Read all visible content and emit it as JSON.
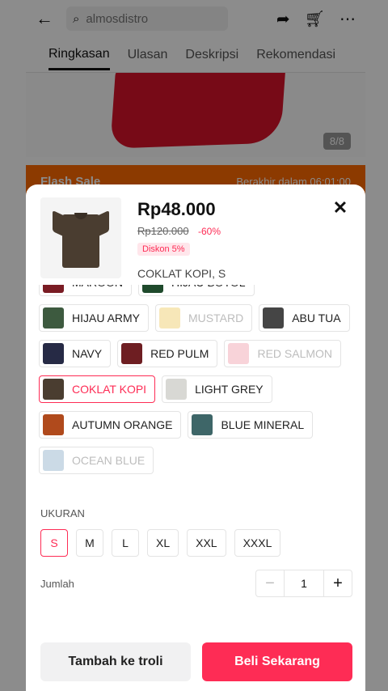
{
  "search": {
    "value": "almosdistro"
  },
  "tabs": [
    "Ringkasan",
    "Ulasan",
    "Deskripsi",
    "Rekomendasi"
  ],
  "gallery": {
    "counter": "8/8"
  },
  "flash": {
    "title": "Flash Sale",
    "timer_label": "Berakhir dalam 06:01:00"
  },
  "product": {
    "price": "Rp48.000",
    "original_price": "Rp120.000",
    "discount_percent": "-60%",
    "discount_badge": "Diskon 5%",
    "selected_variant": "COKLAT KOPI, S"
  },
  "colors": [
    [
      {
        "label": "MAROON",
        "swatch": "#7a1c24",
        "state": "normal"
      },
      {
        "label": "HIJAU BOTOL",
        "swatch": "#1f4a2c",
        "state": "normal"
      }
    ],
    [
      {
        "label": "HIJAU ARMY",
        "swatch": "#3d5a3f",
        "state": "normal"
      },
      {
        "label": "MUSTARD",
        "swatch": "#f2d88a",
        "state": "disabled"
      },
      {
        "label": "ABU TUA",
        "swatch": "#454545",
        "state": "normal"
      }
    ],
    [
      {
        "label": "NAVY",
        "swatch": "#262a45",
        "state": "normal"
      },
      {
        "label": "RED PULM",
        "swatch": "#6e1e22",
        "state": "normal"
      },
      {
        "label": "RED SALMON",
        "swatch": "#f4b7c0",
        "state": "disabled"
      }
    ],
    [
      {
        "label": "COKLAT KOPI",
        "swatch": "#4a3d30",
        "state": "selected"
      },
      {
        "label": "LIGHT GREY",
        "swatch": "#d8d8d4",
        "state": "normal"
      }
    ],
    [
      {
        "label": "AUTUMN ORANGE",
        "swatch": "#b04a1c",
        "state": "normal"
      },
      {
        "label": "BLUE MINERAL",
        "swatch": "#3e6668",
        "state": "normal"
      }
    ],
    [
      {
        "label": "OCEAN BLUE",
        "swatch": "#a9c3d6",
        "state": "disabled"
      }
    ]
  ],
  "size_section": {
    "title": "UKURAN"
  },
  "sizes": [
    {
      "label": "S",
      "selected": true
    },
    {
      "label": "M",
      "selected": false
    },
    {
      "label": "L",
      "selected": false
    },
    {
      "label": "XL",
      "selected": false
    },
    {
      "label": "XXL",
      "selected": false
    },
    {
      "label": "XXXL",
      "selected": false
    }
  ],
  "quantity": {
    "label": "Jumlah",
    "value": "1",
    "minus": "−",
    "plus": "+"
  },
  "actions": {
    "add_to_cart": "Tambah ke troli",
    "buy_now": "Beli Sekarang"
  },
  "theme": {
    "accent": "#fe2c55",
    "flash": "#ff6a00"
  }
}
